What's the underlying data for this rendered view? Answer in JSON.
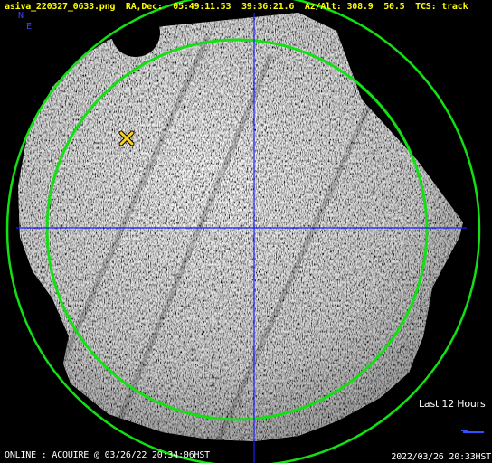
{
  "header": {
    "filename": "asiva_220327_0633.png",
    "radec_label": "RA,Dec:",
    "ra": "05:49:11.53",
    "dec": "39:36:21.6",
    "azalt_label": "Az/Alt:",
    "az": "308.9",
    "alt": "50.5",
    "tcs_label": "TCS:",
    "tcs_state": "track"
  },
  "compass": {
    "north": "N",
    "east": "E"
  },
  "history": {
    "label": "Last 12 Hours"
  },
  "status": {
    "left": "ONLINE : ACQUIRE @ 03/26/22 20:34:06HST",
    "right": "2022/03/26 20:33HST"
  },
  "marker": {
    "icon": "telescope-position-x-icon",
    "color": "#ffd21a"
  },
  "colors": {
    "elevation_circle": "#12e012",
    "horizon_circle": "#12e012",
    "crosshair": "#1a1aff",
    "header_text": "#ffff00",
    "compass_text": "#4040ff"
  }
}
